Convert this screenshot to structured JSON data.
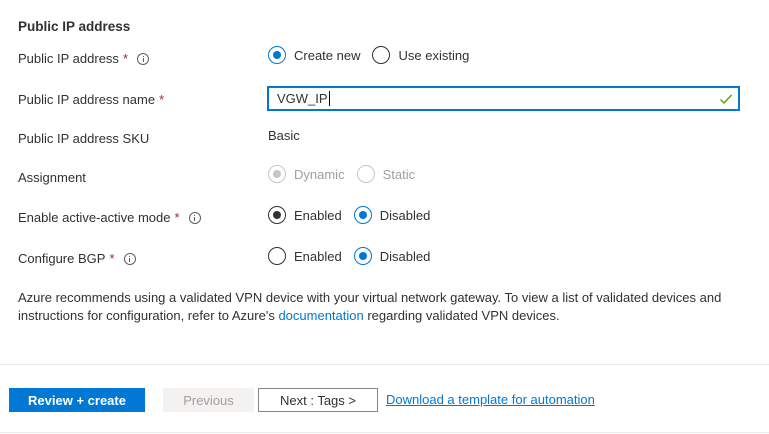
{
  "section": {
    "title": "Public IP address"
  },
  "rows": {
    "public_ip": {
      "label": "Public IP address",
      "required": "*",
      "options": [
        "Create new",
        "Use existing"
      ],
      "selected": "Create new"
    },
    "ip_name": {
      "label": "Public IP address name",
      "required": "*",
      "value": "VGW_IP",
      "valid": true
    },
    "sku": {
      "label": "Public IP address SKU",
      "value": "Basic"
    },
    "assignment": {
      "label": "Assignment",
      "options": [
        "Dynamic",
        "Static"
      ],
      "selected": "Dynamic",
      "disabled": true
    },
    "active_active": {
      "label": "Enable active-active mode",
      "required": "*",
      "options": [
        "Enabled",
        "Disabled"
      ],
      "selected": "Disabled"
    },
    "bgp": {
      "label": "Configure BGP",
      "required": "*",
      "options": [
        "Enabled",
        "Disabled"
      ],
      "selected": "Disabled"
    }
  },
  "notice": {
    "text_before": "Azure recommends using a validated VPN device with your virtual network gateway. To view a list of validated devices and instructions for configuration, refer to Azure's ",
    "link": "documentation",
    "text_after": " regarding validated VPN devices."
  },
  "footer": {
    "review_create": "Review + create",
    "previous": "Previous",
    "next": "Next : Tags >",
    "download_template": "Download a template for automation"
  },
  "colors": {
    "accent": "#0078d4",
    "required": "#a4262c",
    "valid_check": "#57a300"
  },
  "icons": {
    "info": "info-icon",
    "valid": "checkmark-icon"
  }
}
